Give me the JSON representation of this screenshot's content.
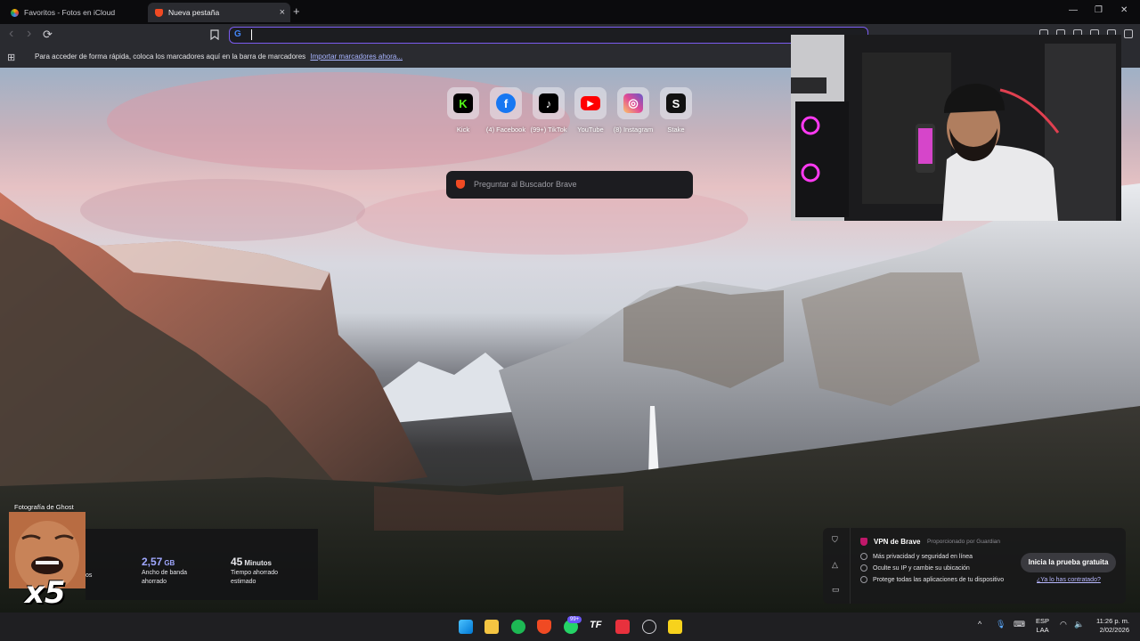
{
  "browser": {
    "tabs": [
      {
        "label": "Favoritos - Fotos en iCloud",
        "active": false
      },
      {
        "label": "Nueva pestaña",
        "active": true
      }
    ],
    "new_tab_symbol": "+",
    "close_symbol": "×",
    "window_controls": [
      "—",
      "❐",
      "✕"
    ],
    "nav": {
      "back": "‹",
      "forward": "›",
      "reload": "⟳",
      "bookmark": "bookmark-icon"
    },
    "address_bar": {
      "engine_glyph": "G",
      "value": ""
    },
    "bookmarks_bar": {
      "message": "Para acceder de forma rápida, coloca los marcadores aquí en la barra de marcadores",
      "link": "Importar marcadores ahora..."
    }
  },
  "new_tab": {
    "top_sites": [
      {
        "label": "Kick",
        "glyph": "K",
        "color": "#53fc18"
      },
      {
        "label": "(4) Facebook",
        "glyph": "f",
        "color": "#1877f2"
      },
      {
        "label": "(99+) TikTok",
        "glyph": "♪",
        "color": "#000000"
      },
      {
        "label": "YouTube",
        "glyph": "▶",
        "color": "#ff0000"
      },
      {
        "label": "(8) Instagram",
        "glyph": "◎",
        "color": "#d6249f"
      },
      {
        "label": "Stake",
        "glyph": "S",
        "color": "#111111"
      }
    ],
    "search_placeholder": "Preguntar al Buscador Brave",
    "photo_credit": "Fotografía de Ghost",
    "stats": [
      {
        "value": "2,57",
        "unit": "GB",
        "label": "Ancho de banda ahorrado",
        "accent": "#a0a8ff"
      },
      {
        "value": "45",
        "unit": "Minutos",
        "label": "Tiempo ahorrado estimado",
        "accent": "#ffffff"
      }
    ],
    "stats_cutoff_label": "os",
    "meme_text": "x5",
    "vpn": {
      "title": "VPN de Brave",
      "provider": "Proporcionado por  Guardian",
      "features": [
        "Más privacidad y seguridad en línea",
        "Oculte su IP y cambie su ubicación",
        "Protege todas las aplicaciones de tu dispositivo"
      ],
      "cta": "Inicia la prueba gratuita",
      "already": "¿Ya lo has contratado?"
    }
  },
  "taskbar": {
    "whatsapp_badge": "99+",
    "language": {
      "line1": "ESP",
      "line2": "LAA"
    },
    "clock": {
      "time": "11:26 p. m.",
      "date": "2/02/2026"
    }
  }
}
